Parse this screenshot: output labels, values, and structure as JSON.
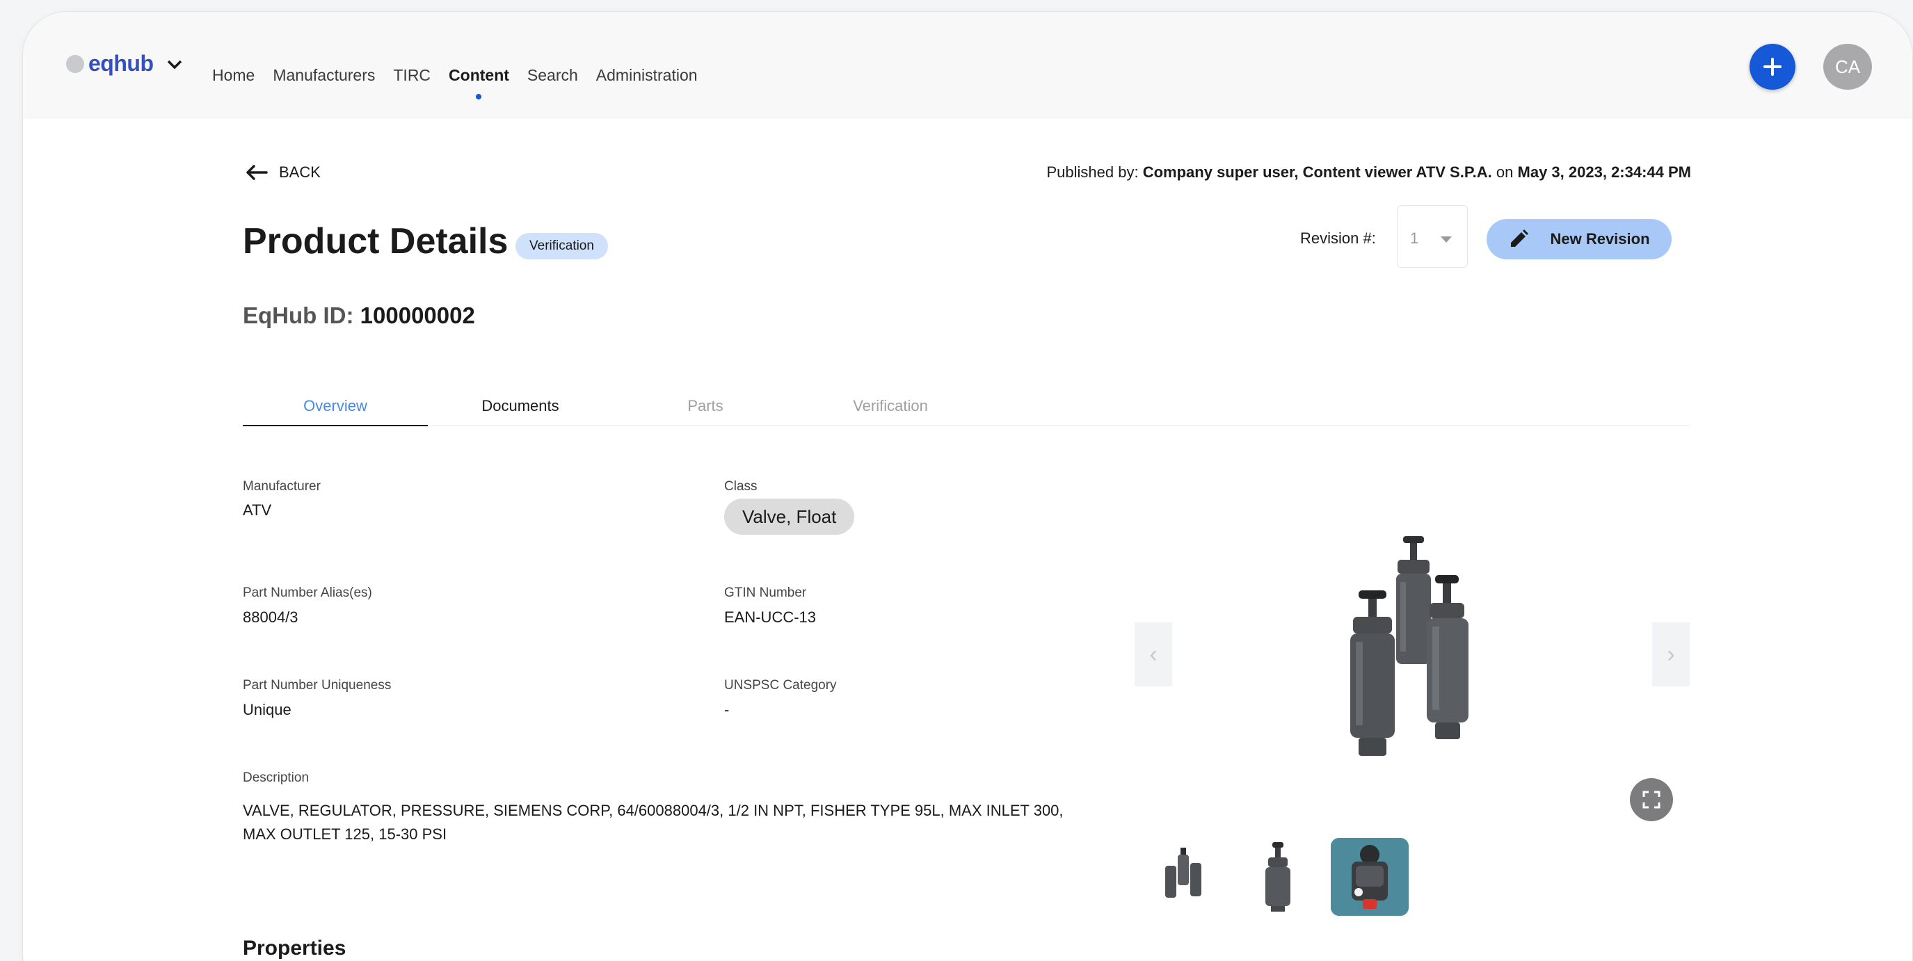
{
  "app": {
    "logo_text": "eqhub",
    "nav": [
      "Home",
      "Manufacturers",
      "TIRC",
      "Content",
      "Search",
      "Administration"
    ],
    "active_nav": "Content",
    "avatar_initials": "CA",
    "accent_color": "#1659d8"
  },
  "header": {
    "back_label": "BACK",
    "published_prefix": "Published by:",
    "published_by": "Company super user, Content viewer ATV S.P.A.",
    "published_on_word": "on",
    "published_date": "May 3, 2023, 2:34:44 PM"
  },
  "product": {
    "title": "Product Details",
    "status_badge": "Verification",
    "revision_label": "Revision #:",
    "revision_value": "1",
    "new_revision_label": "New Revision",
    "eqhub_id_label": "EqHub ID:",
    "eqhub_id": "100000002"
  },
  "tabs": [
    {
      "label": "Overview",
      "state": "active"
    },
    {
      "label": "Documents",
      "state": "normal"
    },
    {
      "label": "Parts",
      "state": "disabled"
    },
    {
      "label": "Verification",
      "state": "disabled"
    }
  ],
  "fields": {
    "manufacturer_label": "Manufacturer",
    "manufacturer": "ATV",
    "class_label": "Class",
    "class": "Valve, Float",
    "alias_label": "Part Number Alias(es)",
    "alias": "88004/3",
    "gtin_label": "GTIN Number",
    "gtin": "EAN-UCC-13",
    "uniqueness_label": "Part Number Uniqueness",
    "uniqueness": "Unique",
    "unspsc_label": "UNSPSC Category",
    "unspsc": "-",
    "description_label": "Description",
    "description": "VALVE, REGULATOR, PRESSURE, SIEMENS CORP, 64/60088004/3, 1/2 IN NPT, FISHER TYPE 95L, MAX INLET 300, MAX OUTLET 125, 15-30 PSI"
  },
  "gallery": {
    "prev_icon": "chevron-left-icon",
    "next_icon": "chevron-right-icon",
    "fullscreen_icon": "expand-icon",
    "thumbnails": 3,
    "selected_thumbnail": 3
  },
  "sections": {
    "properties_heading": "Properties"
  }
}
